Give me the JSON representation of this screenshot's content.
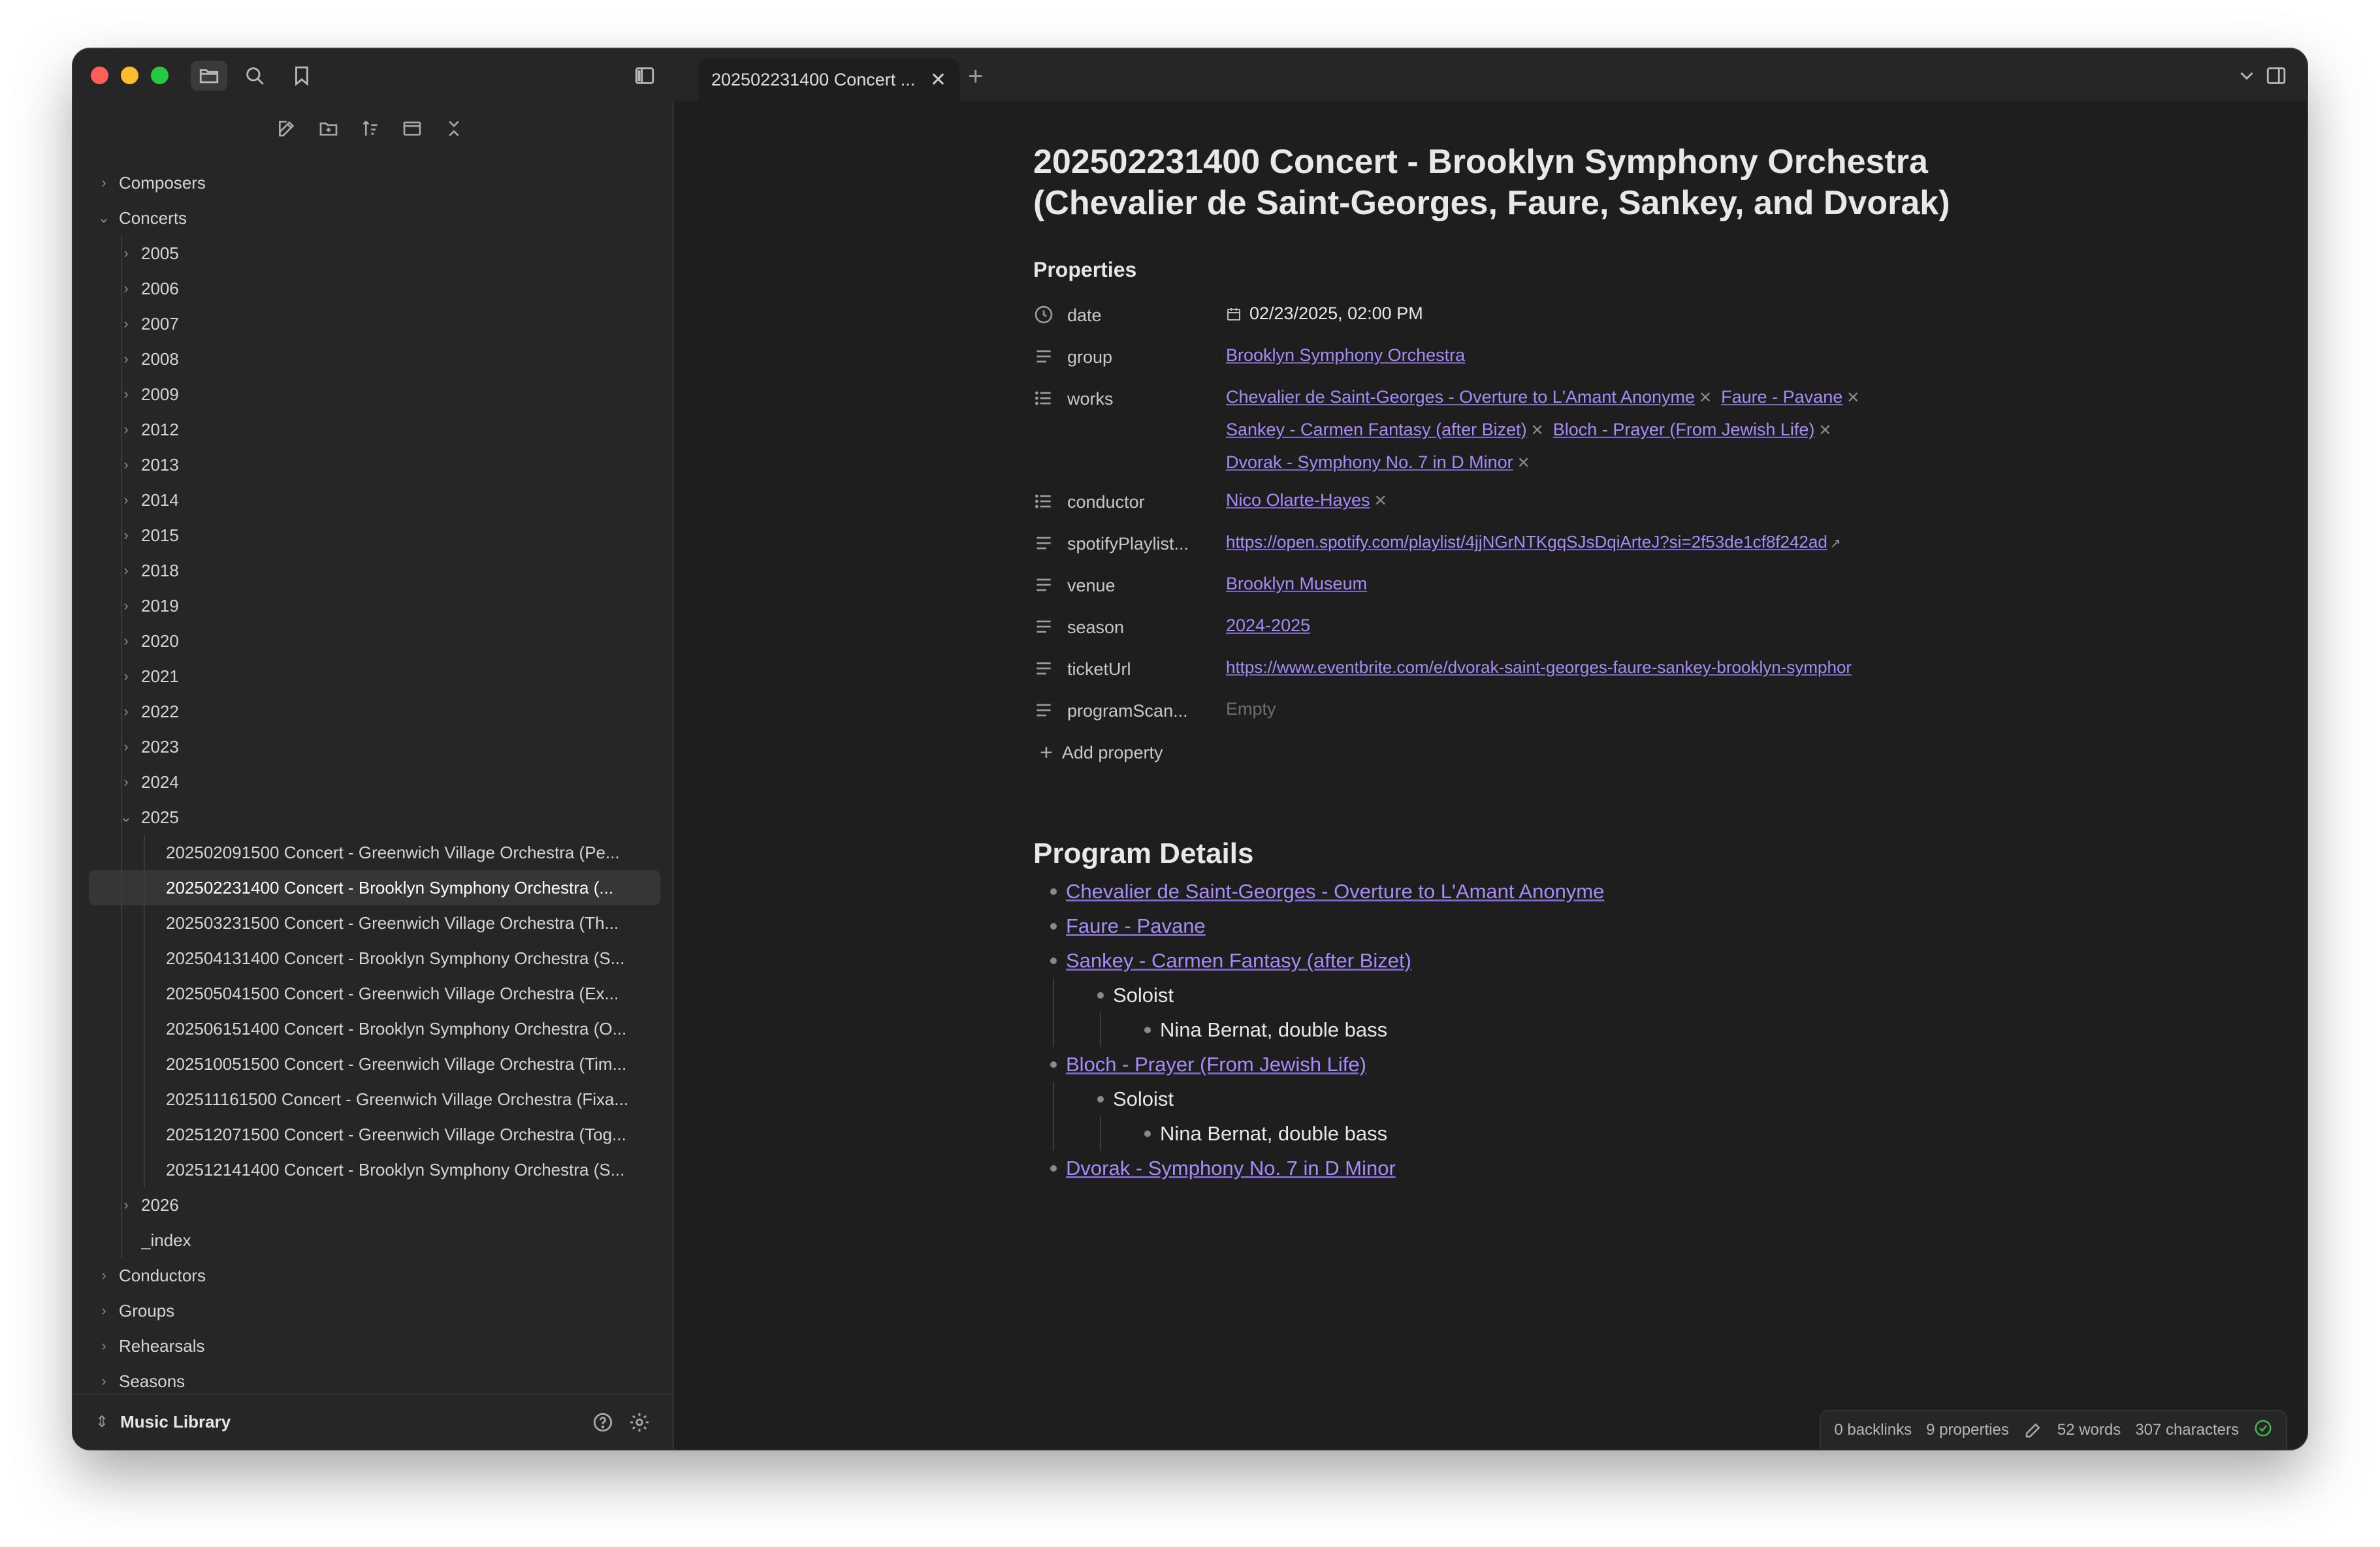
{
  "tab": {
    "label": "202502231400 Concert ...",
    "close": "✕",
    "new": "+"
  },
  "sidebar": {
    "tree": [
      {
        "label": "Composers",
        "level": 0,
        "chevron": "›"
      },
      {
        "label": "Concerts",
        "level": 0,
        "chevron": "⌄"
      },
      {
        "label": "2005",
        "level": 1,
        "chevron": "›"
      },
      {
        "label": "2006",
        "level": 1,
        "chevron": "›"
      },
      {
        "label": "2007",
        "level": 1,
        "chevron": "›"
      },
      {
        "label": "2008",
        "level": 1,
        "chevron": "›"
      },
      {
        "label": "2009",
        "level": 1,
        "chevron": "›"
      },
      {
        "label": "2012",
        "level": 1,
        "chevron": "›"
      },
      {
        "label": "2013",
        "level": 1,
        "chevron": "›"
      },
      {
        "label": "2014",
        "level": 1,
        "chevron": "›"
      },
      {
        "label": "2015",
        "level": 1,
        "chevron": "›"
      },
      {
        "label": "2018",
        "level": 1,
        "chevron": "›"
      },
      {
        "label": "2019",
        "level": 1,
        "chevron": "›"
      },
      {
        "label": "2020",
        "level": 1,
        "chevron": "›"
      },
      {
        "label": "2021",
        "level": 1,
        "chevron": "›"
      },
      {
        "label": "2022",
        "level": 1,
        "chevron": "›"
      },
      {
        "label": "2023",
        "level": 1,
        "chevron": "›"
      },
      {
        "label": "2024",
        "level": 1,
        "chevron": "›"
      },
      {
        "label": "2025",
        "level": 1,
        "chevron": "⌄"
      },
      {
        "label": "202502091500 Concert - Greenwich Village Orchestra (Pe...",
        "level": 2
      },
      {
        "label": "202502231400 Concert - Brooklyn Symphony Orchestra (...",
        "level": 2,
        "selected": true
      },
      {
        "label": "202503231500 Concert - Greenwich Village Orchestra (Th...",
        "level": 2
      },
      {
        "label": "202504131400 Concert - Brooklyn Symphony Orchestra (S...",
        "level": 2
      },
      {
        "label": "202505041500 Concert - Greenwich Village Orchestra (Ex...",
        "level": 2
      },
      {
        "label": "202506151400 Concert - Brooklyn Symphony Orchestra (O...",
        "level": 2
      },
      {
        "label": "202510051500 Concert - Greenwich Village Orchestra (Tim...",
        "level": 2
      },
      {
        "label": "202511161500 Concert - Greenwich Village Orchestra (Fixa...",
        "level": 2
      },
      {
        "label": "202512071500 Concert - Greenwich Village Orchestra (Tog...",
        "level": 2
      },
      {
        "label": "202512141400 Concert - Brooklyn Symphony Orchestra (S...",
        "level": 2
      },
      {
        "label": "2026",
        "level": 1,
        "chevron": "›"
      },
      {
        "label": "_index",
        "level": 1,
        "chevron": ""
      },
      {
        "label": "Conductors",
        "level": 0,
        "chevron": "›"
      },
      {
        "label": "Groups",
        "level": 0,
        "chevron": "›"
      },
      {
        "label": "Rehearsals",
        "level": 0,
        "chevron": "›"
      },
      {
        "label": "Seasons",
        "level": 0,
        "chevron": "›"
      }
    ],
    "vault_name": "Music Library"
  },
  "note": {
    "title": "202502231400 Concert - Brooklyn Symphony Orchestra (Chevalier de Saint-Georges, Faure, Sankey, and Dvorak)",
    "properties_heading": "Properties",
    "properties": {
      "date": {
        "name": "date",
        "value": "02/23/2025, 02:00 PM"
      },
      "group": {
        "name": "group",
        "value": "Brooklyn Symphony Orchestra"
      },
      "works": {
        "name": "works",
        "values": [
          "Chevalier de Saint-Georges - Overture to L'Amant Anonyme",
          "Faure - Pavane",
          "Sankey - Carmen Fantasy (after Bizet)",
          "Bloch - Prayer (From Jewish Life)",
          "Dvorak - Symphony No. 7 in D Minor"
        ]
      },
      "conductor": {
        "name": "conductor",
        "value": "Nico Olarte-Hayes"
      },
      "spotify": {
        "name": "spotifyPlaylist...",
        "value": "https://open.spotify.com/playlist/4jjNGrNTKgqSJsDqiArteJ?si=2f53de1cf8f242ad"
      },
      "venue": {
        "name": "venue",
        "value": "Brooklyn Museum"
      },
      "season": {
        "name": "season",
        "value": "2024-2025"
      },
      "ticket": {
        "name": "ticketUrl",
        "value": "https://www.eventbrite.com/e/dvorak-saint-georges-faure-sankey-brooklyn-symphor"
      },
      "program": {
        "name": "programScan...",
        "value": "Empty"
      }
    },
    "remove_glyph": "✕",
    "add_property": "Add property",
    "program_heading": "Program Details",
    "program": [
      {
        "text": "Chevalier de Saint-Georges - Overture to L'Amant Anonyme",
        "depth": 0,
        "link": true
      },
      {
        "text": "Faure - Pavane",
        "depth": 0,
        "link": true
      },
      {
        "text": "Sankey - Carmen Fantasy (after Bizet)",
        "depth": 0,
        "link": true
      },
      {
        "text": "Soloist",
        "depth": 1,
        "link": false
      },
      {
        "text": "Nina Bernat, double bass",
        "depth": 2,
        "link": false
      },
      {
        "text": "Bloch - Prayer (From Jewish Life)",
        "depth": 0,
        "link": true
      },
      {
        "text": "Soloist",
        "depth": 1,
        "link": false
      },
      {
        "text": "Nina Bernat, double bass",
        "depth": 2,
        "link": false
      },
      {
        "text": "Dvorak - Symphony No. 7 in D Minor",
        "depth": 0,
        "link": true
      }
    ]
  },
  "status": {
    "backlinks": "0 backlinks",
    "properties": "9 properties",
    "words": "52 words",
    "characters": "307 characters"
  },
  "icons": [
    "folder-icon",
    "search-icon",
    "bookmark-icon",
    "sidebar-toggle-icon",
    "new-note-icon",
    "new-folder-icon",
    "sort-icon",
    "collapse-icon",
    "close-all-icon",
    "clock-icon",
    "text-lines-icon",
    "list-icon",
    "calendar-icon",
    "external-link-icon",
    "help-icon",
    "gear-icon",
    "pencil-icon",
    "check-circle-icon",
    "chevron-down-icon",
    "right-sidebar-icon"
  ]
}
